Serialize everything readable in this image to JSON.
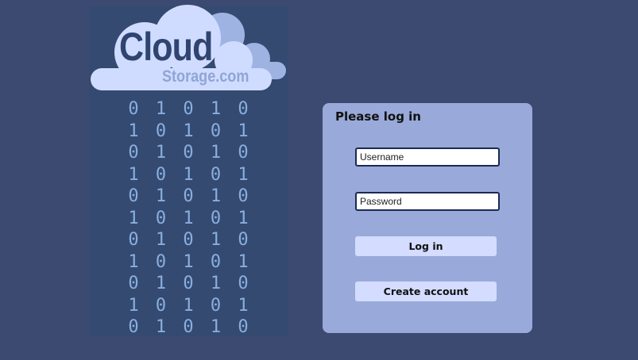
{
  "logo": {
    "primary": "Cloud",
    "secondary": "Storage.com",
    "colors": {
      "cloud_light": "#d0dcff",
      "cloud_mid": "#9fb3e3",
      "text": "#2f4470",
      "sub_text": "#8ea5d6"
    }
  },
  "binary_rows": [
    [
      "0",
      "1",
      "0",
      "1",
      "0"
    ],
    [
      "1",
      "0",
      "1",
      "0",
      "1"
    ],
    [
      "0",
      "1",
      "0",
      "1",
      "0"
    ],
    [
      "1",
      "0",
      "1",
      "0",
      "1"
    ],
    [
      "0",
      "1",
      "0",
      "1",
      "0"
    ],
    [
      "1",
      "0",
      "1",
      "0",
      "1"
    ],
    [
      "0",
      "1",
      "0",
      "1",
      "0"
    ],
    [
      "1",
      "0",
      "1",
      "0",
      "1"
    ],
    [
      "0",
      "1",
      "0",
      "1",
      "0"
    ],
    [
      "1",
      "0",
      "1",
      "0",
      "1"
    ],
    [
      "0",
      "1",
      "0",
      "1",
      "0"
    ]
  ],
  "login": {
    "title": "Please log in",
    "username_placeholder": "Username",
    "password_placeholder": "Password",
    "login_label": "Log in",
    "create_label": "Create account"
  },
  "colors": {
    "background": "#3c4a72",
    "panel": "#344a70",
    "card": "#99a9d9",
    "button": "#d4dcff",
    "binary": "#89aee0"
  }
}
